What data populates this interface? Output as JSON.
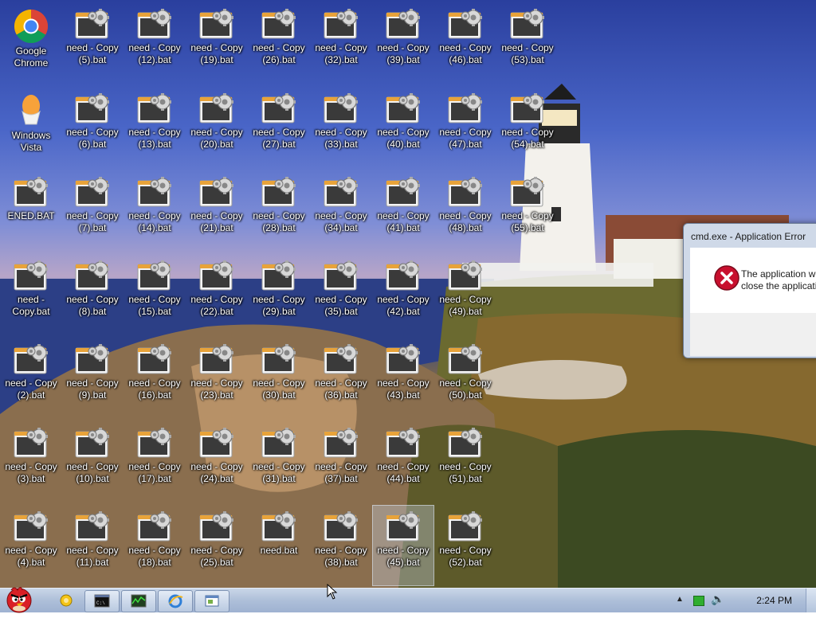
{
  "desktop": {
    "icons": [
      {
        "label": "Google\nChrome",
        "type": "chrome",
        "col": 0,
        "row": 0
      },
      {
        "label": "Windows\nVista",
        "type": "egg",
        "col": 0,
        "row": 1
      },
      {
        "label": "ENED.BAT",
        "type": "bat",
        "col": 0,
        "row": 2
      },
      {
        "label": "need -\nCopy.bat",
        "type": "bat",
        "col": 0,
        "row": 3
      },
      {
        "label": "need - Copy\n(2).bat",
        "type": "bat",
        "col": 0,
        "row": 4
      },
      {
        "label": "need - Copy\n(3).bat",
        "type": "bat",
        "col": 0,
        "row": 5
      },
      {
        "label": "need - Copy\n(4).bat",
        "type": "bat",
        "col": 0,
        "row": 6
      },
      {
        "label": "need - Copy\n(5).bat",
        "type": "bat",
        "col": 1,
        "row": 0
      },
      {
        "label": "need - Copy\n(6).bat",
        "type": "bat",
        "col": 1,
        "row": 1
      },
      {
        "label": "need - Copy\n(7).bat",
        "type": "bat",
        "col": 1,
        "row": 2
      },
      {
        "label": "need - Copy\n(8).bat",
        "type": "bat",
        "col": 1,
        "row": 3
      },
      {
        "label": "need - Copy\n(9).bat",
        "type": "bat",
        "col": 1,
        "row": 4
      },
      {
        "label": "need - Copy\n(10).bat",
        "type": "bat",
        "col": 1,
        "row": 5
      },
      {
        "label": "need - Copy\n(11).bat",
        "type": "bat",
        "col": 1,
        "row": 6
      },
      {
        "label": "need - Copy\n(12).bat",
        "type": "bat",
        "col": 2,
        "row": 0
      },
      {
        "label": "need - Copy\n(13).bat",
        "type": "bat",
        "col": 2,
        "row": 1
      },
      {
        "label": "need - Copy\n(14).bat",
        "type": "bat",
        "col": 2,
        "row": 2
      },
      {
        "label": "need - Copy\n(15).bat",
        "type": "bat",
        "col": 2,
        "row": 3
      },
      {
        "label": "need - Copy\n(16).bat",
        "type": "bat",
        "col": 2,
        "row": 4
      },
      {
        "label": "need - Copy\n(17).bat",
        "type": "bat",
        "col": 2,
        "row": 5
      },
      {
        "label": "need - Copy\n(18).bat",
        "type": "bat",
        "col": 2,
        "row": 6
      },
      {
        "label": "need - Copy\n(19).bat",
        "type": "bat",
        "col": 3,
        "row": 0
      },
      {
        "label": "need - Copy\n(20).bat",
        "type": "bat",
        "col": 3,
        "row": 1
      },
      {
        "label": "need - Copy\n(21).bat",
        "type": "bat",
        "col": 3,
        "row": 2
      },
      {
        "label": "need - Copy\n(22).bat",
        "type": "bat",
        "col": 3,
        "row": 3
      },
      {
        "label": "need - Copy\n(23).bat",
        "type": "bat",
        "col": 3,
        "row": 4
      },
      {
        "label": "need - Copy\n(24).bat",
        "type": "bat",
        "col": 3,
        "row": 5
      },
      {
        "label": "need - Copy\n(25).bat",
        "type": "bat",
        "col": 3,
        "row": 6
      },
      {
        "label": "need - Copy\n(26).bat",
        "type": "bat",
        "col": 4,
        "row": 0
      },
      {
        "label": "need - Copy\n(27).bat",
        "type": "bat",
        "col": 4,
        "row": 1
      },
      {
        "label": "need - Copy\n(28).bat",
        "type": "bat",
        "col": 4,
        "row": 2
      },
      {
        "label": "need - Copy\n(29).bat",
        "type": "bat",
        "col": 4,
        "row": 3
      },
      {
        "label": "need - Copy\n(30).bat",
        "type": "bat",
        "col": 4,
        "row": 4
      },
      {
        "label": "need - Copy\n(31).bat",
        "type": "bat",
        "col": 4,
        "row": 5
      },
      {
        "label": "need.bat",
        "type": "bat",
        "col": 4,
        "row": 6
      },
      {
        "label": "need - Copy\n(32).bat",
        "type": "bat",
        "col": 5,
        "row": 0
      },
      {
        "label": "need - Copy\n(33).bat",
        "type": "bat",
        "col": 5,
        "row": 1
      },
      {
        "label": "need - Copy\n(34).bat",
        "type": "bat",
        "col": 5,
        "row": 2
      },
      {
        "label": "need - Copy\n(35).bat",
        "type": "bat",
        "col": 5,
        "row": 3
      },
      {
        "label": "need - Copy\n(36).bat",
        "type": "bat",
        "col": 5,
        "row": 4
      },
      {
        "label": "need - Copy\n(37).bat",
        "type": "bat",
        "col": 5,
        "row": 5
      },
      {
        "label": "need - Copy\n(38).bat",
        "type": "bat",
        "col": 5,
        "row": 6
      },
      {
        "label": "need - Copy\n(39).bat",
        "type": "bat",
        "col": 6,
        "row": 0
      },
      {
        "label": "need - Copy\n(40).bat",
        "type": "bat",
        "col": 6,
        "row": 1
      },
      {
        "label": "need - Copy\n(41).bat",
        "type": "bat",
        "col": 6,
        "row": 2
      },
      {
        "label": "need - Copy\n(42).bat",
        "type": "bat",
        "col": 6,
        "row": 3
      },
      {
        "label": "need - Copy\n(43).bat",
        "type": "bat",
        "col": 6,
        "row": 4
      },
      {
        "label": "need - Copy\n(44).bat",
        "type": "bat",
        "col": 6,
        "row": 5
      },
      {
        "label": "need - Copy\n(45).bat",
        "type": "bat",
        "col": 6,
        "row": 6,
        "selected": true
      },
      {
        "label": "need - Copy\n(46).bat",
        "type": "bat",
        "col": 7,
        "row": 0
      },
      {
        "label": "need - Copy\n(47).bat",
        "type": "bat",
        "col": 7,
        "row": 1
      },
      {
        "label": "need - Copy\n(48).bat",
        "type": "bat",
        "col": 7,
        "row": 2
      },
      {
        "label": "need - Copy\n(49).bat",
        "type": "bat",
        "col": 7,
        "row": 3
      },
      {
        "label": "need - Copy\n(50).bat",
        "type": "bat",
        "col": 7,
        "row": 4
      },
      {
        "label": "need - Copy\n(51).bat",
        "type": "bat",
        "col": 7,
        "row": 5
      },
      {
        "label": "need - Copy\n(52).bat",
        "type": "bat",
        "col": 7,
        "row": 6
      },
      {
        "label": "need - Copy\n(53).bat",
        "type": "bat",
        "col": 8,
        "row": 0
      },
      {
        "label": "need - Copy\n(54).bat",
        "type": "bat",
        "col": 8,
        "row": 1
      },
      {
        "label": "need - Copy\n(55).bat",
        "type": "bat",
        "col": 8,
        "row": 2
      }
    ]
  },
  "dialog": {
    "title": "cmd.exe - Application Error",
    "message_line1": "The application w",
    "message_line2": "close the applicati"
  },
  "taskbar": {
    "start_icon": "angry-bird-orb-icon",
    "items": [
      {
        "name": "taskbar-cmd",
        "icon": "cmd-icon",
        "running": true
      },
      {
        "name": "taskbar-task-manager",
        "icon": "task-manager-icon",
        "running": true
      },
      {
        "name": "taskbar-ie",
        "icon": "internet-explorer-icon",
        "running": true
      },
      {
        "name": "taskbar-app-window",
        "icon": "window-icon",
        "running": true
      }
    ],
    "clock": "2:24 PM"
  },
  "colors": {
    "taskbar": "#aebfd9",
    "dialog_frame": "#cfd9e8",
    "error_red": "#c8102e"
  }
}
